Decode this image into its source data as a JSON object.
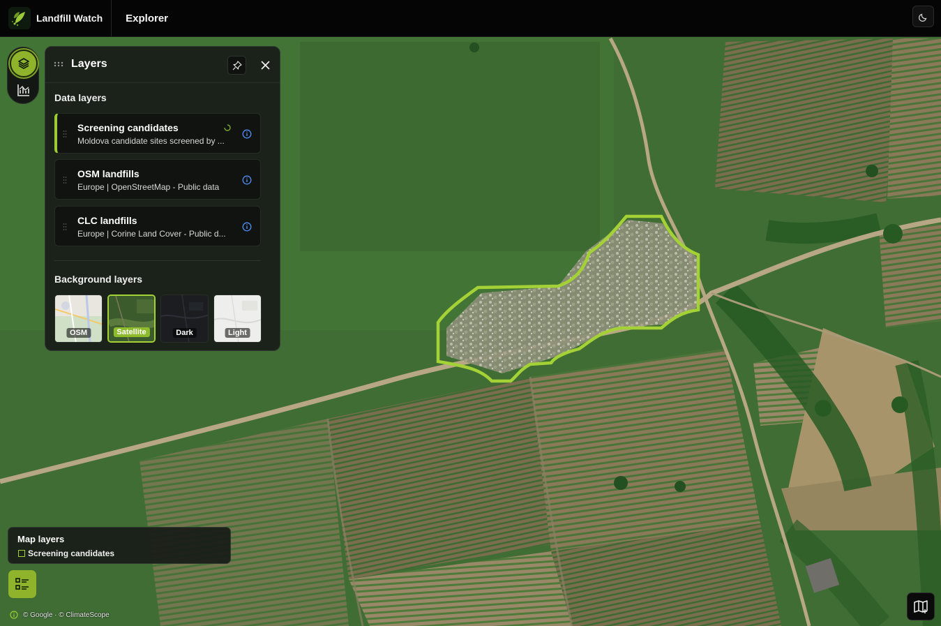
{
  "app": {
    "name": "Landfill Watch",
    "nav_explorer": "Explorer"
  },
  "panel": {
    "title": "Layers",
    "data_layers_title": "Data layers",
    "data_layers": [
      {
        "title": "Screening candidates",
        "subtitle": "Moldova candidate sites screened by ...",
        "active": true,
        "loading": true
      },
      {
        "title": "OSM landfills",
        "subtitle": "Europe | OpenStreetMap - Public data",
        "active": false
      },
      {
        "title": "CLC landfills",
        "subtitle": "Europe | Corine Land Cover - Public d...",
        "active": false
      }
    ],
    "background_layers_title": "Background layers",
    "background_layers": [
      {
        "label": "OSM",
        "selected": false
      },
      {
        "label": "Satellite",
        "selected": true
      },
      {
        "label": "Dark",
        "selected": false
      },
      {
        "label": "Light",
        "selected": false
      }
    ]
  },
  "legend": {
    "title": "Map layers",
    "items": [
      "Screening candidates"
    ]
  },
  "attribution": "© Google · © ClimateScope",
  "colors": {
    "accent": "#8fb42c",
    "candidate_outline": "#a4d236",
    "panel_bg": "#181c18",
    "info_blue": "#4f8ff7"
  },
  "icons": {
    "logo": "landfill-watch-logo",
    "theme": "moon-icon",
    "rail_layers": "layers-icon",
    "rail_chart": "chart-icon",
    "pin": "pin-icon",
    "close": "close-icon",
    "info": "info-icon",
    "legend_toggle": "list-icon",
    "basemap": "map-icon"
  }
}
